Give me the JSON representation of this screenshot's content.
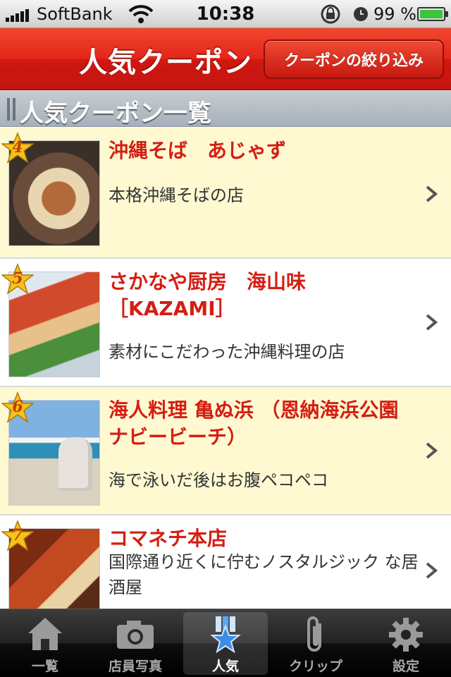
{
  "status_bar": {
    "carrier": "SoftBank",
    "time": "10:38",
    "battery_percent": "99 %",
    "battery_level": 0.99
  },
  "nav": {
    "title": "人気クーポン",
    "filter_button_label": "クーポンの絞り込み"
  },
  "section": {
    "title": "人気クーポン一覧"
  },
  "items": [
    {
      "rank": "4",
      "title": "沖縄そば　あじゃず",
      "description": "本格沖縄そばの店",
      "thumb_icon": "okinawa-soba-photo"
    },
    {
      "rank": "5",
      "title": "さかなや厨房　海山味［KAZAMI］",
      "description": "素材にこだわった沖縄料理の店",
      "thumb_icon": "sashimi-photo"
    },
    {
      "rank": "6",
      "title": "海人料理 亀ぬ浜 （恩納海浜公園ナビービーチ）",
      "description": "海で泳いだ後はお腹ペコペコ",
      "thumb_icon": "beach-shisa-photo"
    },
    {
      "rank": "7",
      "title": "コマネチ本店",
      "description": "国際通り近くに佇むノスタルジック な居酒屋",
      "thumb_icon": "izakaya-photo"
    }
  ],
  "tabs": [
    {
      "label": "一覧",
      "icon": "home-icon",
      "active": false
    },
    {
      "label": "店員写真",
      "icon": "camera-icon",
      "active": false
    },
    {
      "label": "人気",
      "icon": "ribbon-star-icon",
      "active": true
    },
    {
      "label": "クリップ",
      "icon": "paperclip-icon",
      "active": false
    },
    {
      "label": "設定",
      "icon": "gear-icon",
      "active": false
    }
  ],
  "colors": {
    "nav_red": "#e2261a",
    "title_red": "#d41e12",
    "odd_row": "#fff9d2",
    "star_gold": "#f7c21d"
  }
}
